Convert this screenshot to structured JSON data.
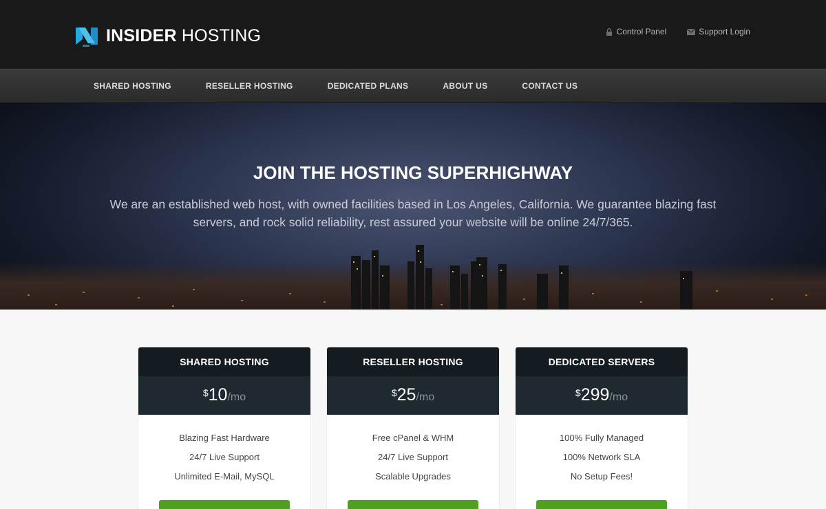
{
  "header": {
    "logo_bold": "INSIDER",
    "logo_light": "HOSTING",
    "links": [
      {
        "label": "Control Panel",
        "icon": "lock-icon"
      },
      {
        "label": "Support Login",
        "icon": "envelope-icon"
      }
    ]
  },
  "nav": {
    "items": [
      "SHARED HOSTING",
      "RESELLER HOSTING",
      "DEDICATED PLANS",
      "ABOUT US",
      "CONTACT US"
    ]
  },
  "hero": {
    "title": "JOIN THE HOSTING SUPERHIGHWAY",
    "text": "We are an established web host, with owned facilities based in Los Angeles, California. We guarantee blazing fast servers, and rock solid reliability, rest assured your website will be online 24/7/365."
  },
  "plans": [
    {
      "name": "SHARED HOSTING",
      "currency": "$",
      "price": "10",
      "period": "/mo",
      "features": [
        "Blazing Fast Hardware",
        "24/7 Live Support",
        "Unlimited E-Mail, MySQL"
      ]
    },
    {
      "name": "RESELLER HOSTING",
      "currency": "$",
      "price": "25",
      "period": "/mo",
      "features": [
        "Free cPanel & WHM",
        "24/7 Live Support",
        "Scalable Upgrades"
      ]
    },
    {
      "name": "DEDICATED SERVERS",
      "currency": "$",
      "price": "299",
      "period": "/mo",
      "features": [
        "100% Fully Managed",
        "100% Network SLA",
        "No Setup Fees!"
      ]
    }
  ],
  "colors": {
    "topbar": "#191919",
    "accent_blue": "#29a8e0",
    "button_green": "#4ea01e",
    "plan_header": "#141c22"
  }
}
